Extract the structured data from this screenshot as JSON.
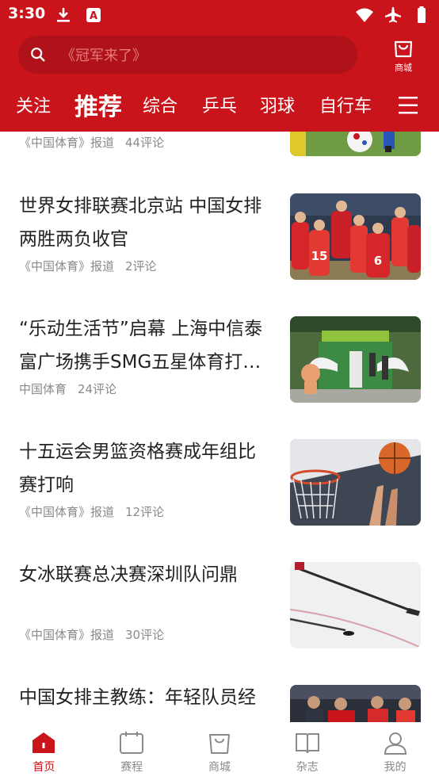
{
  "status_bar": {
    "time": "3:30",
    "left_icons": [
      "download-icon",
      "text-app-icon"
    ],
    "right_icons": [
      "wifi-icon",
      "airplane-icon",
      "battery-icon"
    ]
  },
  "search": {
    "placeholder": "《冠军来了》"
  },
  "shop": {
    "label": "商城",
    "icon": "shopping-bag-icon"
  },
  "tabs": [
    {
      "label": "关注",
      "active": false
    },
    {
      "label": "推荐",
      "active": true
    },
    {
      "label": "综合",
      "active": false
    },
    {
      "label": "乒乓",
      "active": false
    },
    {
      "label": "羽球",
      "active": false
    },
    {
      "label": "自行车",
      "active": false
    }
  ],
  "menu_icon": "menu-icon",
  "feed": [
    {
      "title": "",
      "source": "《中国体育》报道",
      "comments": "44评论",
      "thumb": "soccer-photo"
    },
    {
      "title": "世界女排联赛北京站 中国女排两胜两负收官",
      "source": "《中国体育》报道",
      "comments": "2评论",
      "thumb": "volleyball-team-photo"
    },
    {
      "title": "“乐动生活节”启幕 上海中信泰富广场携手SMG五星体育打…",
      "source": "中国体育",
      "comments": "24评论",
      "thumb": "event-stage-photo"
    },
    {
      "title": "十五运会男篮资格赛成年组比赛打响",
      "source": "《中国体育》报道",
      "comments": "12评论",
      "thumb": "basketball-photo"
    },
    {
      "title": "女冰联赛总决赛深圳队问鼎",
      "source": "《中国体育》报道",
      "comments": "30评论",
      "thumb": "ice-hockey-photo"
    },
    {
      "title": "中国女排主教练：年轻队员经",
      "source": "",
      "comments": "",
      "thumb": "coach-photo"
    }
  ],
  "bottom_nav": [
    {
      "label": "首页",
      "icon": "home-icon",
      "active": true
    },
    {
      "label": "赛程",
      "icon": "calendar-icon",
      "active": false
    },
    {
      "label": "商城",
      "icon": "shopping-bag-icon",
      "active": false
    },
    {
      "label": "杂志",
      "icon": "book-icon",
      "active": false
    },
    {
      "label": "我的",
      "icon": "user-icon",
      "active": false
    }
  ],
  "colors": {
    "brand_red": "#c8141a",
    "search_bg": "#b0121a",
    "title_text": "#222222",
    "meta_text": "#8a8a8a"
  }
}
